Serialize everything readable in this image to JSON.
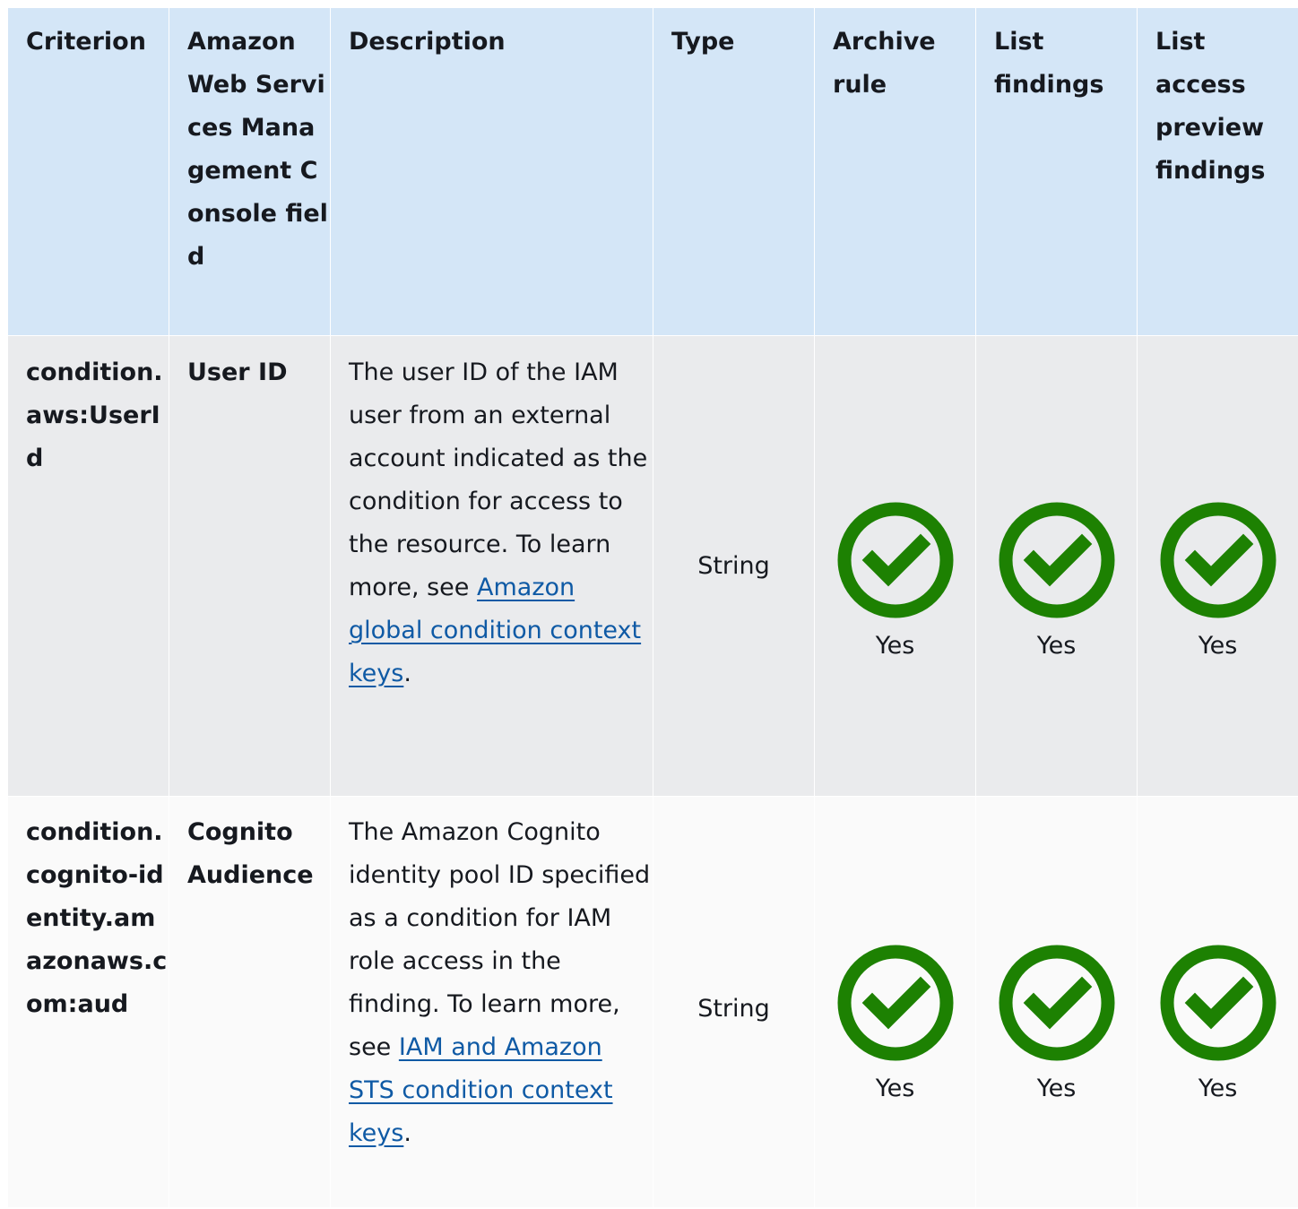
{
  "headers": [
    "Criterion",
    "Amazon Web Services Management Console field",
    "Description",
    "Type",
    "Archive rule",
    "List findings",
    "List access preview findings"
  ],
  "rows": [
    {
      "criterion": "condition.aws:UserId",
      "field": "User ID",
      "description": "The user ID of the IAM user from an external account indicated as the condition for access to the resource. To learn more, see",
      "link_text": "Amazon global condition context keys",
      "after_link": ".",
      "type": "String",
      "archive_rule": "Yes",
      "list_findings": "Yes",
      "list_access_preview_findings": "Yes"
    },
    {
      "criterion": "condition.cognito-identity.amazonaws.com:aud",
      "field": "Cognito Audience",
      "description": "The Amazon Cognito identity pool ID specified as a condition for IAM role access in the finding. To learn more, see",
      "link_text": "IAM and Amazon STS condition context keys",
      "after_link": ".",
      "type": "String",
      "archive_rule": "Yes",
      "list_findings": "Yes",
      "list_access_preview_findings": "Yes"
    }
  ],
  "icons": {
    "support": "check-circle-icon"
  },
  "colors": {
    "header_bg": "#d4e6f7",
    "row1_bg": "#eaebed",
    "row2_bg": "#fafafa",
    "check": "#1d8102",
    "link": "#0f5aa5"
  }
}
